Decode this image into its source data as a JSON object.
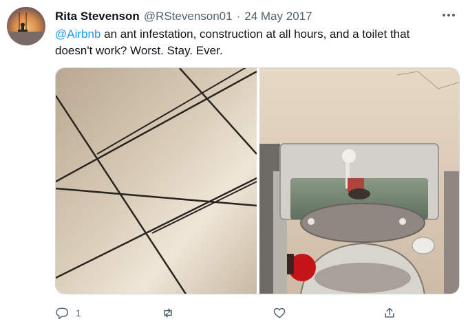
{
  "tweet": {
    "author_name": "Rita Stevenson",
    "handle": "@RStevenson01",
    "separator": "·",
    "date": "24 May 2017",
    "mention": "@Airbnb",
    "text_line1": " an ant infestation, construction at all hours, and a toilet that",
    "text_line2": "doesn't work? Worst. Stay. Ever."
  },
  "actions": {
    "reply_count": "1",
    "retweet_count": "",
    "like_count": ""
  },
  "icons": {
    "more": "more-dots-icon",
    "reply": "reply-icon",
    "retweet": "retweet-icon",
    "like": "heart-icon",
    "share": "share-icon"
  },
  "colors": {
    "accent": "#1d9bf0",
    "secondary_text": "#536471"
  }
}
